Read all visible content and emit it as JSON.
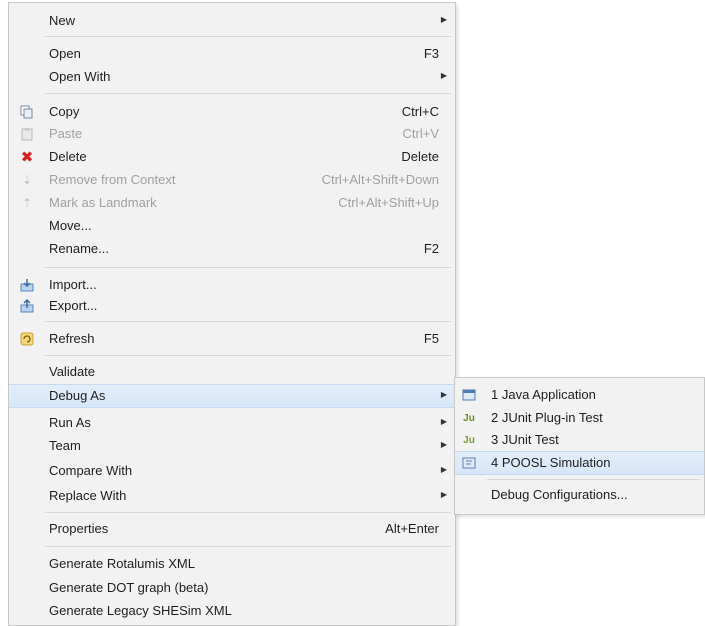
{
  "context_menu": {
    "items": [
      {
        "label": "New",
        "shortcut": "",
        "submenu": true
      },
      {
        "label": "Open",
        "shortcut": "F3"
      },
      {
        "label": "Open With",
        "shortcut": "",
        "submenu": true
      },
      {
        "label": "Copy",
        "shortcut": "Ctrl+C",
        "icon": "copy-icon"
      },
      {
        "label": "Paste",
        "shortcut": "Ctrl+V",
        "icon": "paste-icon",
        "disabled": true
      },
      {
        "label": "Delete",
        "shortcut": "Delete",
        "icon": "delete-icon"
      },
      {
        "label": "Remove from Context",
        "shortcut": "Ctrl+Alt+Shift+Down",
        "icon": "remove-context-icon",
        "disabled": true
      },
      {
        "label": "Mark as Landmark",
        "shortcut": "Ctrl+Alt+Shift+Up",
        "icon": "landmark-icon",
        "disabled": true
      },
      {
        "label": "Move...",
        "shortcut": ""
      },
      {
        "label": "Rename...",
        "shortcut": "F2"
      },
      {
        "label": "Import...",
        "shortcut": "",
        "icon": "import-icon"
      },
      {
        "label": "Export...",
        "shortcut": "",
        "icon": "export-icon"
      },
      {
        "label": "Refresh",
        "shortcut": "F5",
        "icon": "refresh-icon"
      },
      {
        "label": "Validate",
        "shortcut": ""
      },
      {
        "label": "Debug As",
        "shortcut": "",
        "submenu": true,
        "selected": true
      },
      {
        "label": "Run As",
        "shortcut": "",
        "submenu": true
      },
      {
        "label": "Team",
        "shortcut": "",
        "submenu": true
      },
      {
        "label": "Compare With",
        "shortcut": "",
        "submenu": true
      },
      {
        "label": "Replace With",
        "shortcut": "",
        "submenu": true
      },
      {
        "label": "Properties",
        "shortcut": "Alt+Enter"
      },
      {
        "label": "Generate Rotalumis XML",
        "shortcut": ""
      },
      {
        "label": "Generate DOT graph (beta)",
        "shortcut": ""
      },
      {
        "label": "Generate Legacy SHESim XML",
        "shortcut": ""
      }
    ]
  },
  "debug_submenu": {
    "items": [
      {
        "label": "1 Java Application",
        "icon": "java-app-icon"
      },
      {
        "label": "2 JUnit Plug-in Test",
        "icon": "junit-plugin-icon"
      },
      {
        "label": "3 JUnit Test",
        "icon": "junit-icon"
      },
      {
        "label": "4 POOSL Simulation",
        "icon": "poosl-icon",
        "selected": true
      },
      {
        "label": "Debug Configurations...",
        "icon": ""
      }
    ]
  },
  "colors": {
    "menu_bg": "#f2f2f2",
    "hover": "#d7e6f8",
    "disabled_text": "#a0a0a0",
    "delete_red": "#d42020"
  }
}
